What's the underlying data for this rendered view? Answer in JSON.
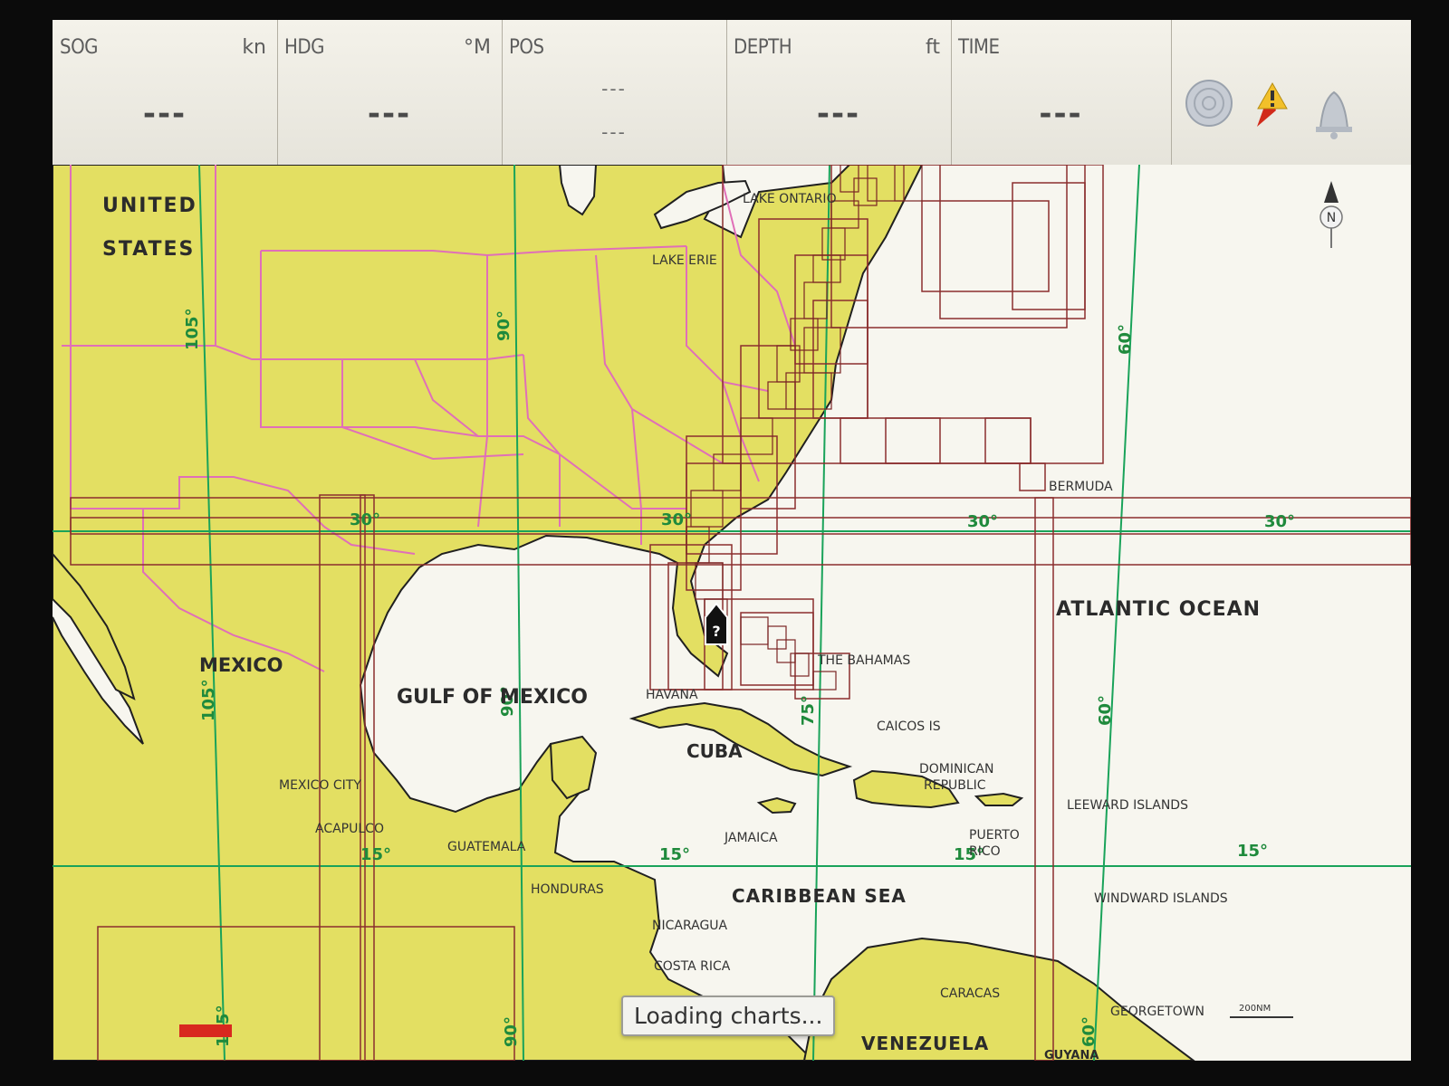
{
  "databar": {
    "cells": [
      {
        "label": "SOG",
        "unit": "kn",
        "value": "---"
      },
      {
        "label": "HDG",
        "unit": "°M",
        "value": "---"
      },
      {
        "label": "POS",
        "unit": "",
        "value_line1": "---",
        "value_line2": "---"
      },
      {
        "label": "DEPTH",
        "unit": "ft",
        "value": "---"
      },
      {
        "label": "TIME",
        "unit": "",
        "value": "---"
      }
    ],
    "icons": [
      "gps-satellite-icon",
      "mob-warning-icon",
      "alarm-bell-icon"
    ]
  },
  "map": {
    "north_label": "N",
    "regions": {
      "united": "UNITED",
      "states": "STATES",
      "mexico": "MEXICO",
      "gulf": "GULF OF MEXICO",
      "atlantic": "ATLANTIC OCEAN",
      "cuba": "CUBA",
      "caribbean": "CARIBBEAN SEA",
      "venezuela": "VENEZUELA",
      "guyana": "GUYANA"
    },
    "places": {
      "lake_ontario": "LAKE ONTARIO",
      "lake_erie": "LAKE ERIE",
      "bermuda": "BERMUDA",
      "bahamas": "THE BAHAMAS",
      "caicos": "CAICOS IS",
      "dominican": "DOMINICAN",
      "republic": "REPUBLIC",
      "leeward": "LEEWARD ISLANDS",
      "windward": "WINDWARD ISLANDS",
      "havana": "HAVANA",
      "jamaica": "JAMAICA",
      "puerto": "PUERTO",
      "rico": "RICO",
      "mexico_city": "MEXICO CITY",
      "acapulco": "ACAPULCO",
      "guatemala": "GUATEMALA",
      "honduras": "HONDURAS",
      "nicaragua": "NICARAGUA",
      "costa_rica": "COSTA RICA",
      "caracas": "CARACAS",
      "georgetown": "GEORGETOWN"
    },
    "grid_labels": {
      "lon105": "105°",
      "lon90": "90°",
      "lon75": "75°",
      "lon60": "60°",
      "lat30": "30°",
      "lat15": "15°"
    },
    "scale": "200NM",
    "vessel_symbol": "?"
  },
  "status": {
    "loading": "Loading charts..."
  },
  "colors": {
    "land": "#e3df62",
    "sea": "#f7f6ef",
    "grid": "#1aa35a",
    "chart_bounds": "#8b2e2e",
    "state_borders": "#e06fb8"
  }
}
